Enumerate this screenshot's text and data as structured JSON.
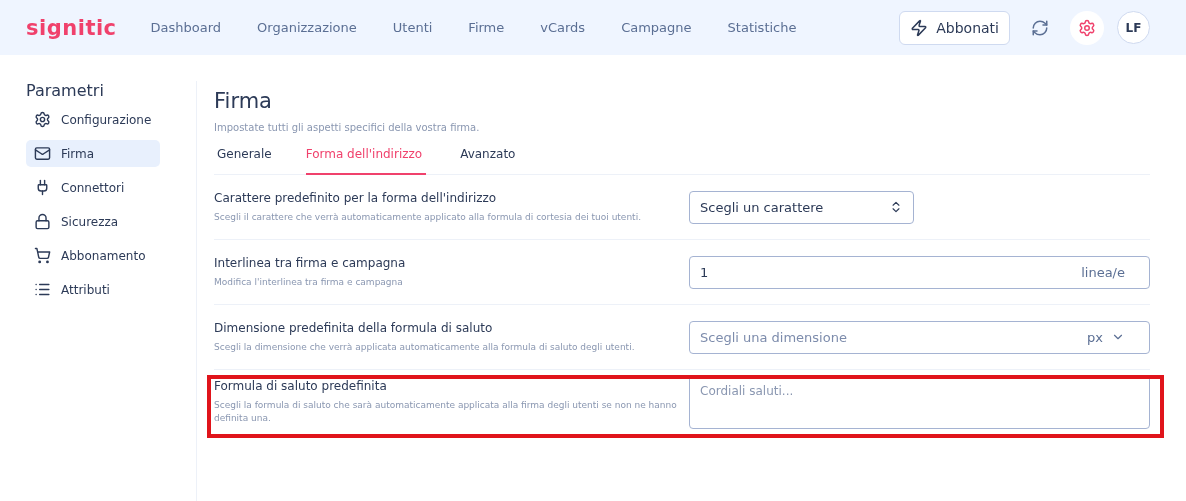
{
  "header": {
    "logo": "signitic",
    "nav": [
      {
        "label": "Dashboard"
      },
      {
        "label": "Organizzazione"
      },
      {
        "label": "Utenti"
      },
      {
        "label": "Firme"
      },
      {
        "label": "vCards"
      },
      {
        "label": "Campagne"
      },
      {
        "label": "Statistiche"
      }
    ],
    "subscribe_button": "Abbonati",
    "avatar": "LF"
  },
  "sidebar": {
    "title": "Parametri",
    "items": [
      {
        "label": "Configurazione",
        "selected": false
      },
      {
        "label": "Firma",
        "selected": true
      },
      {
        "label": "Connettori",
        "selected": false
      },
      {
        "label": "Sicurezza",
        "selected": false
      },
      {
        "label": "Abbonamento",
        "selected": false
      },
      {
        "label": "Attributi",
        "selected": false
      }
    ]
  },
  "page": {
    "title": "Firma",
    "subtitle": "Impostate tutti gli aspetti specifici della vostra firma.",
    "tabs": [
      {
        "label": "Generale",
        "selected": false
      },
      {
        "label": "Forma dell'indirizzo",
        "selected": true
      },
      {
        "label": "Avanzato",
        "selected": false
      }
    ],
    "settings": [
      {
        "kind": "select",
        "label": "Carattere predefinito per la forma dell'indirizzo",
        "description": "Scegli il carattere che verrà automaticamente applicato alla formula di cortesia dei tuoi utenti.",
        "value": "Scegli un carattere",
        "highlighted": false
      },
      {
        "kind": "number",
        "label": "Interlinea tra firma e campagna",
        "description": "Modifica l'interlinea tra firma e campagna",
        "value": "1",
        "unit": "linea/e",
        "highlighted": false
      },
      {
        "kind": "size",
        "label": "Dimensione predefinita della formula di saluto",
        "description": "Scegli la dimensione che verrà applicata automaticamente alla formula di saluto degli utenti.",
        "placeholder": "Scegli una dimensione",
        "unit": "px",
        "highlighted": false
      },
      {
        "kind": "textarea",
        "label": "Formula di saluto predefinita",
        "description": "Scegli la formula di saluto che sarà automaticamente applicata alla firma degli utenti se non ne hanno definita una.",
        "placeholder": "Cordiali saluti...",
        "highlighted": true
      }
    ]
  }
}
